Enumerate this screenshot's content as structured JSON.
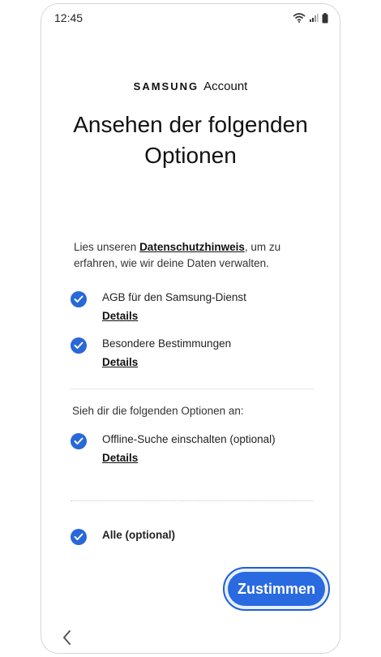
{
  "status": {
    "time": "12:45"
  },
  "brand": {
    "samsung": "SAMSUNG",
    "account": "Account"
  },
  "title": "Ansehen der folgenden Optionen",
  "intro": {
    "prefix": "Lies unseren ",
    "link": "Datenschutzhinweis",
    "suffix": ", um zu erfahren, wie wir deine Daten verwalten."
  },
  "items": [
    {
      "label": "AGB für den Samsung-Dienst",
      "details": "Details"
    },
    {
      "label": "Besondere Bestimmungen",
      "details": "Details"
    }
  ],
  "optional_section": {
    "label": "Sieh dir die folgenden Optionen an:",
    "items": [
      {
        "label": "Offline-Suche einschalten (optional)",
        "details": "Details"
      }
    ]
  },
  "all": {
    "label": "Alle (optional)"
  },
  "agree_button": "Zustimmen",
  "colors": {
    "accent": "#2a6ae0",
    "check": "#2868d8"
  },
  "icons": [
    "wifi-icon",
    "signal-icon",
    "battery-icon",
    "check-icon",
    "back-chevron-icon"
  ]
}
